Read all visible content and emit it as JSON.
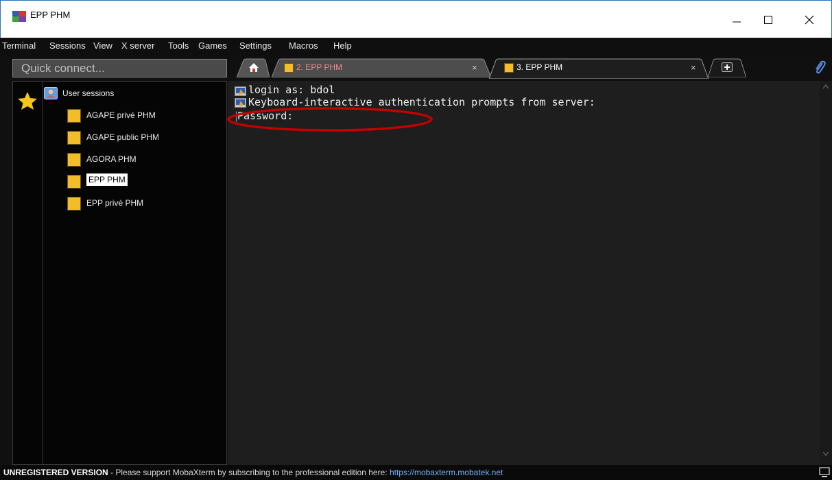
{
  "window": {
    "title": "EPP PHM"
  },
  "menu": [
    "Terminal",
    "Sessions",
    "View",
    "X server",
    "Tools",
    "Games",
    "Settings",
    "Macros",
    "Help"
  ],
  "quick_connect": {
    "placeholder": "Quick connect..."
  },
  "tabs": [
    {
      "label": "2. EPP PHM",
      "active": false,
      "color": "#f08a8a"
    },
    {
      "label": "3. EPP PHM",
      "active": true,
      "color": "#ffffff"
    }
  ],
  "sessions": {
    "root_label": "User sessions",
    "items": [
      {
        "label": "AGAPE privé PHM"
      },
      {
        "label": "AGAPE public  PHM"
      },
      {
        "label": "AGORA PHM"
      },
      {
        "label": "EPP PHM",
        "selected": true
      },
      {
        "label": "EPP privé PHM"
      }
    ]
  },
  "terminal": {
    "lines": [
      "login as: bdol",
      "Keyboard-interactive authentication prompts from server:",
      "Password: "
    ]
  },
  "status": {
    "bold": "UNREGISTERED VERSION",
    "text": "  -  Please support MobaXterm by subscribing to the professional edition here:  ",
    "link": "https://mobaxterm.mobatek.net"
  },
  "colors": {
    "accent": "#2b6cc4",
    "annotation": "#c40000",
    "star": "#f5c518",
    "key": "#f2bd2b"
  }
}
